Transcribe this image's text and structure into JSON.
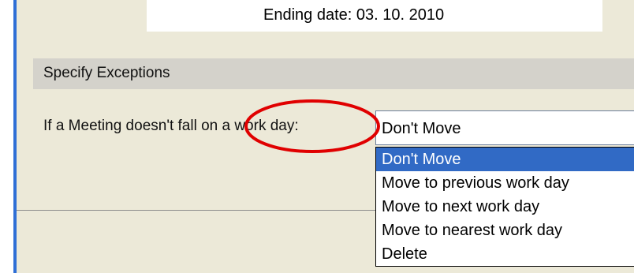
{
  "dialog": {
    "ending_date_label": "Ending date: 03. 10. 2010"
  },
  "exceptions": {
    "section_title": "Specify Exceptions",
    "question_label": "If a Meeting doesn't fall on a work day:",
    "selected_value": "Don't Move",
    "options": [
      {
        "label": "Don't Move",
        "selected": true
      },
      {
        "label": "Move to previous work day",
        "selected": false
      },
      {
        "label": "Move to next work day",
        "selected": false
      },
      {
        "label": "Move to nearest work day",
        "selected": false
      },
      {
        "label": "Delete",
        "selected": false
      }
    ]
  },
  "colors": {
    "accent_blue": "#316ac5",
    "panel_background": "#ece9d8",
    "annotation_red": "#e00000"
  }
}
